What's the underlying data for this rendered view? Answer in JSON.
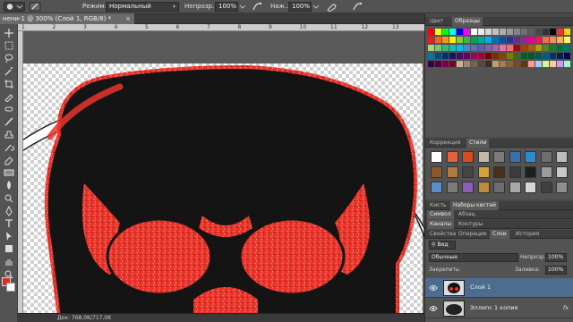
{
  "options_bar": {
    "mode_label": "Режим:",
    "mode_value": "Нормальный",
    "opacity_label": "Непрозр.:",
    "opacity_value": "100%",
    "flow_label": "Наж.:",
    "flow_value": "100%"
  },
  "document": {
    "tab_title": "нени-1 @ 300% (Слой 1, RGB/8) *",
    "close_glyph": "×",
    "status": "Док: 768,0K/717,0K"
  },
  "ruler": {
    "ticks": [
      "1",
      "2",
      "3",
      "4",
      "5",
      "6",
      "7",
      "8",
      "9",
      "10",
      "11",
      "12",
      "13"
    ]
  },
  "panels": {
    "color_tabs": [
      "Цвет",
      "Образцы"
    ],
    "adjust_tabs": [
      "Коррекция",
      "Стили"
    ],
    "brush_tabs": [
      "Кисть",
      "Наборы кистей"
    ],
    "char_tabs": [
      "Символ",
      "Абзац"
    ],
    "channels_tabs": [
      "Каналы",
      "Контуры"
    ],
    "layers_tabs": [
      "Свойства",
      "Операции",
      "Слои",
      "История"
    ]
  },
  "layers": {
    "filter_label": "Вид",
    "blend_mode": "Обычные",
    "opacity_label": "Непрозр.:",
    "opacity_value": "100%",
    "lock_label": "Закрепить:",
    "fill_label": "Заливка:",
    "fill_value": "100%",
    "items": [
      {
        "name": "Слой 1",
        "fx": ""
      },
      {
        "name": "Эллипс 1 копия",
        "fx": "fx"
      }
    ]
  },
  "colors": {
    "foreground": "#e42a1d",
    "background": "#ffffff",
    "selection": "#4d6d8e"
  },
  "icons": [
    "move-icon",
    "marquee-icon",
    "lasso-icon",
    "magic-wand-icon",
    "crop-icon",
    "eyedropper-icon",
    "healing-icon",
    "brush-icon",
    "stamp-icon",
    "history-brush-icon",
    "eraser-icon",
    "gradient-icon",
    "blur-icon",
    "dodge-icon",
    "pen-icon",
    "type-icon",
    "path-select-icon",
    "shape-icon",
    "hand-icon",
    "zoom-icon"
  ]
}
